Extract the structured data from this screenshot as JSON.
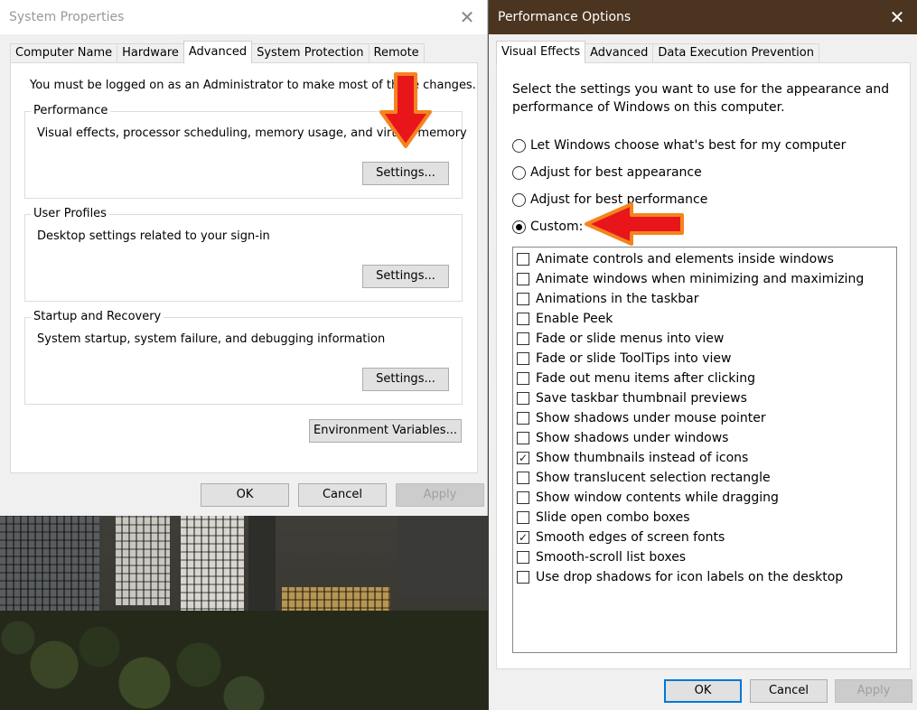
{
  "system_properties": {
    "title": "System Properties",
    "tabs": [
      "Computer Name",
      "Hardware",
      "Advanced",
      "System Protection",
      "Remote"
    ],
    "active_tab": "Advanced",
    "admin_notice": "You must be logged on as an Administrator to make most of these changes.",
    "groups": [
      {
        "title": "Performance",
        "description": "Visual effects, processor scheduling, memory usage, and virtual memory",
        "button": "Settings..."
      },
      {
        "title": "User Profiles",
        "description": "Desktop settings related to your sign-in",
        "button": "Settings..."
      },
      {
        "title": "Startup and Recovery",
        "description": "System startup, system failure, and debugging information",
        "button": "Settings..."
      }
    ],
    "env_button": "Environment Variables...",
    "ok": "OK",
    "cancel": "Cancel",
    "apply": "Apply"
  },
  "performance_options": {
    "title": "Performance Options",
    "tabs": [
      "Visual Effects",
      "Advanced",
      "Data Execution Prevention"
    ],
    "active_tab": "Visual Effects",
    "intro": "Select the settings you want to use for the appearance and performance of Windows on this computer.",
    "radio_options": [
      {
        "label": "Let Windows choose what's best for my computer",
        "checked": false
      },
      {
        "label": "Adjust for best appearance",
        "checked": false
      },
      {
        "label": "Adjust for best performance",
        "checked": false
      },
      {
        "label": "Custom:",
        "checked": true
      }
    ],
    "effects": [
      {
        "label": "Animate controls and elements inside windows",
        "checked": false
      },
      {
        "label": "Animate windows when minimizing and maximizing",
        "checked": false
      },
      {
        "label": "Animations in the taskbar",
        "checked": false
      },
      {
        "label": "Enable Peek",
        "checked": false
      },
      {
        "label": "Fade or slide menus into view",
        "checked": false
      },
      {
        "label": "Fade or slide ToolTips into view",
        "checked": false
      },
      {
        "label": "Fade out menu items after clicking",
        "checked": false
      },
      {
        "label": "Save taskbar thumbnail previews",
        "checked": false
      },
      {
        "label": "Show shadows under mouse pointer",
        "checked": false
      },
      {
        "label": "Show shadows under windows",
        "checked": false
      },
      {
        "label": "Show thumbnails instead of icons",
        "checked": true
      },
      {
        "label": "Show translucent selection rectangle",
        "checked": false
      },
      {
        "label": "Show window contents while dragging",
        "checked": false
      },
      {
        "label": "Slide open combo boxes",
        "checked": false
      },
      {
        "label": "Smooth edges of screen fonts",
        "checked": true
      },
      {
        "label": "Smooth-scroll list boxes",
        "checked": false
      },
      {
        "label": "Use drop shadows for icon labels on the desktop",
        "checked": false
      }
    ],
    "ok": "OK",
    "cancel": "Cancel",
    "apply": "Apply"
  },
  "icons": {
    "close": "close-icon",
    "check": "checkmark-icon",
    "annotation_arrow": "red-arrow-icon"
  },
  "colors": {
    "perf_titlebar": "#4b3520",
    "default_button_border": "#0078d7",
    "annotation_red": "#e8161b",
    "annotation_orange": "#f5831f"
  }
}
